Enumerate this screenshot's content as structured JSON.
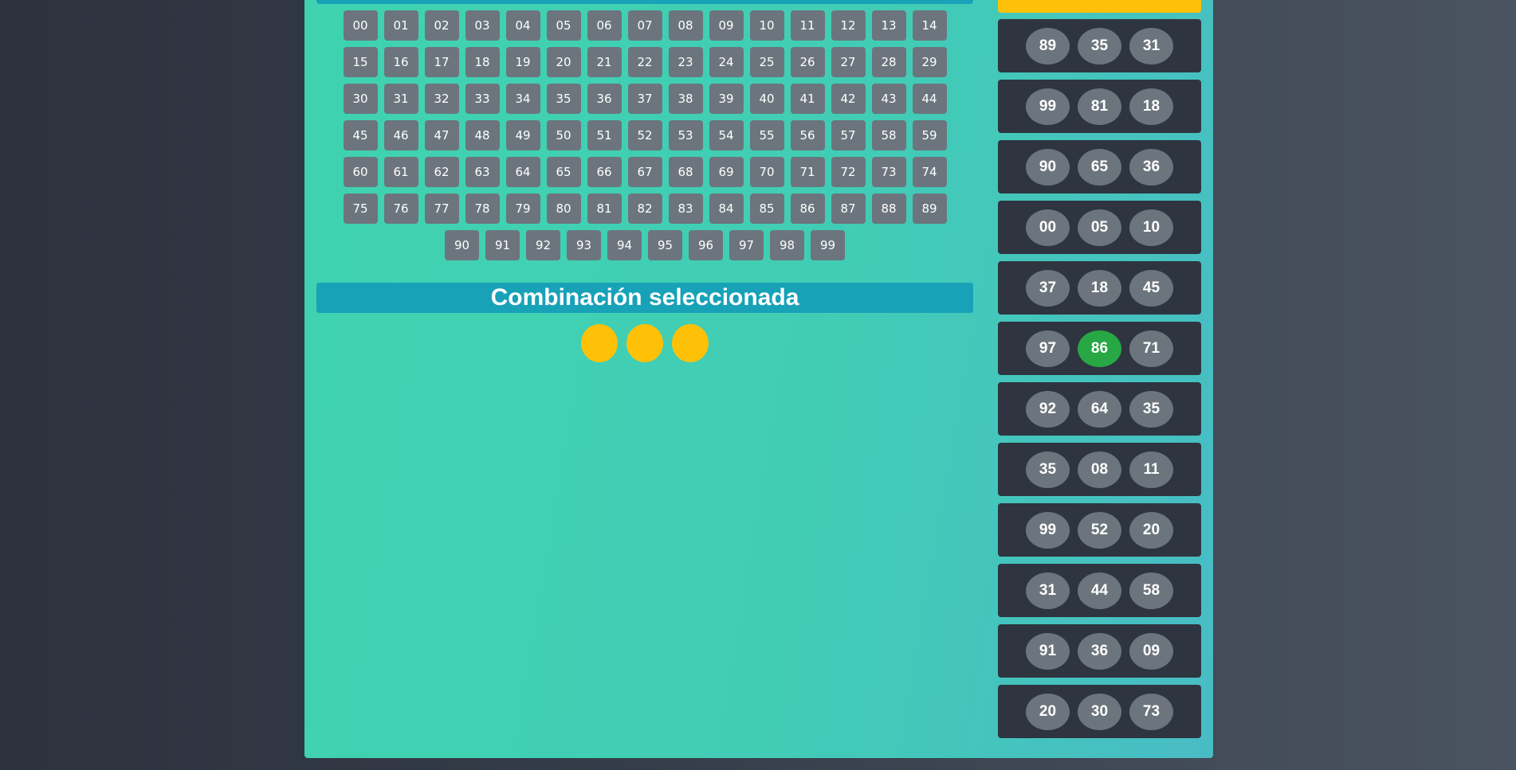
{
  "numbers_grid": [
    [
      "00",
      "01",
      "02",
      "03",
      "04",
      "05",
      "06",
      "07",
      "08",
      "09",
      "10",
      "11",
      "12",
      "13",
      "14"
    ],
    [
      "15",
      "16",
      "17",
      "18",
      "19",
      "20",
      "21",
      "22",
      "23",
      "24",
      "25",
      "26",
      "27",
      "28",
      "29"
    ],
    [
      "30",
      "31",
      "32",
      "33",
      "34",
      "35",
      "36",
      "37",
      "38",
      "39",
      "40",
      "41",
      "42",
      "43",
      "44"
    ],
    [
      "45",
      "46",
      "47",
      "48",
      "49",
      "50",
      "51",
      "52",
      "53",
      "54",
      "55",
      "56",
      "57",
      "58",
      "59"
    ],
    [
      "60",
      "61",
      "62",
      "63",
      "64",
      "65",
      "66",
      "67",
      "68",
      "69",
      "70",
      "71",
      "72",
      "73",
      "74"
    ],
    [
      "75",
      "76",
      "77",
      "78",
      "79",
      "80",
      "81",
      "82",
      "83",
      "84",
      "85",
      "86",
      "87",
      "88",
      "89"
    ],
    [
      "90",
      "91",
      "92",
      "93",
      "94",
      "95",
      "96",
      "97",
      "98",
      "99"
    ]
  ],
  "selection": {
    "title": "Combinación seleccionada",
    "slots": 3
  },
  "history": [
    {
      "numbers": [
        "89",
        "35",
        "31"
      ]
    },
    {
      "numbers": [
        "99",
        "81",
        "18"
      ]
    },
    {
      "numbers": [
        "90",
        "65",
        "36"
      ]
    },
    {
      "numbers": [
        "00",
        "05",
        "10"
      ]
    },
    {
      "numbers": [
        "37",
        "18",
        "45"
      ]
    },
    {
      "numbers": [
        "97",
        "86",
        "71"
      ],
      "highlight": 1
    },
    {
      "numbers": [
        "92",
        "64",
        "35"
      ]
    },
    {
      "numbers": [
        "35",
        "08",
        "11"
      ]
    },
    {
      "numbers": [
        "99",
        "52",
        "20"
      ]
    },
    {
      "numbers": [
        "31",
        "44",
        "58"
      ]
    },
    {
      "numbers": [
        "91",
        "36",
        "09"
      ]
    },
    {
      "numbers": [
        "20",
        "30",
        "73"
      ]
    }
  ],
  "colors": {
    "button": "#6c757d",
    "title_bar": "#17a2b8",
    "selected_slot": "#ffc107",
    "highlight": "#28a745",
    "card": "#2e3540"
  }
}
